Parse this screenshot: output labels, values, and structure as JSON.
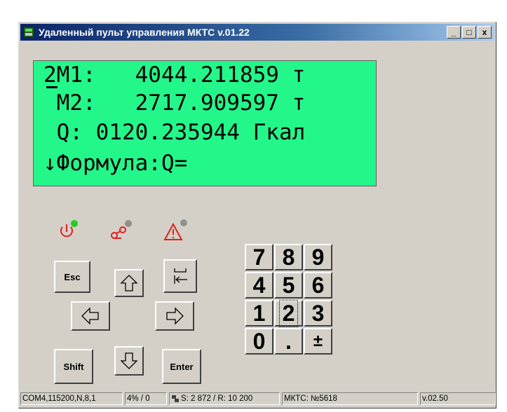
{
  "window": {
    "title": "Удаленный пульт управления МКТС v.01.22",
    "minimize": "_",
    "maximize": "□",
    "close": "x"
  },
  "lcd": {
    "lines": [
      "2M1:   4044.211859 т",
      " M2:   2717.909597 т",
      " Q: 0120.235944 Гкал",
      "↓Формула:Q="
    ],
    "background": "#23f78a"
  },
  "indicators": [
    {
      "icon": "power-icon",
      "color": "#e02020",
      "led": "#22cc22"
    },
    {
      "icon": "connection-icon",
      "color": "#e02020",
      "led": "#909090"
    },
    {
      "icon": "warning-icon",
      "color": "#e02020",
      "led": "#909090"
    }
  ],
  "keys": {
    "esc": "Esc",
    "shift": "Shift",
    "enter": "Enter",
    "numpad": [
      "7",
      "8",
      "9",
      "4",
      "5",
      "6",
      "1",
      "2",
      "3",
      "0",
      ".",
      "±"
    ]
  },
  "status": {
    "port": "COM4,115200,N,8,1",
    "load": "4% / 0",
    "traffic": "S: 2 872 / R: 10 200",
    "device": "МКТС: №5618",
    "version": "v.02.50"
  }
}
